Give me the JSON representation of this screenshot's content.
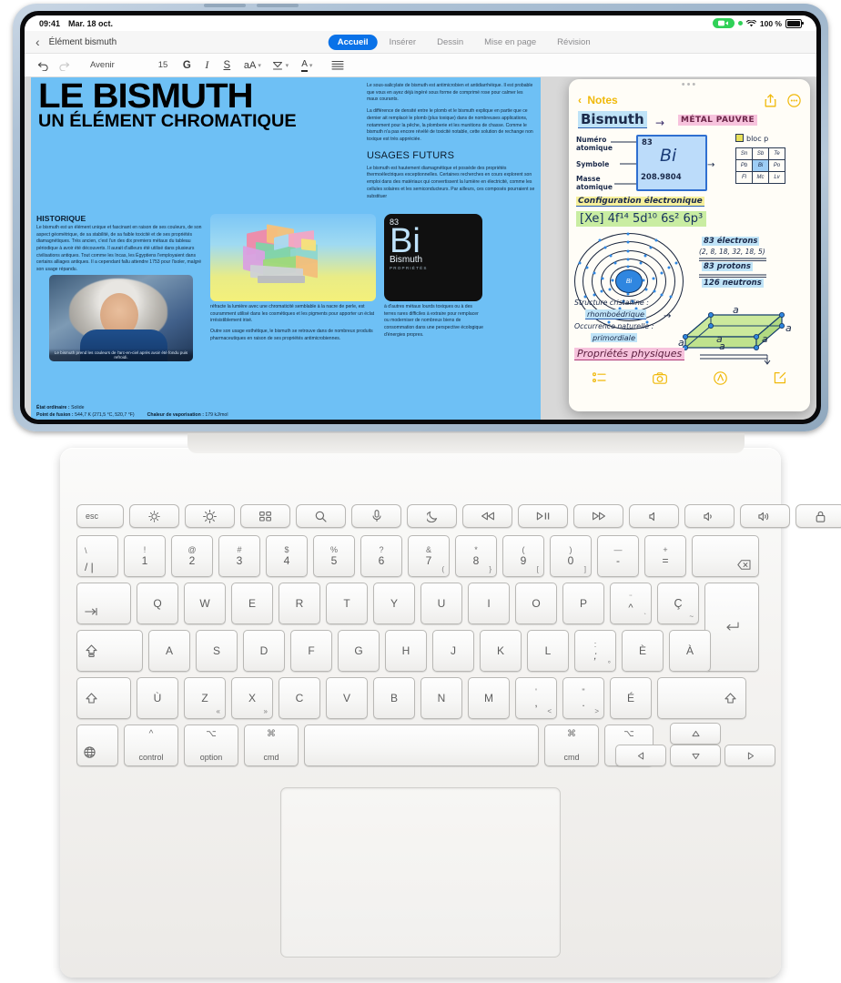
{
  "device": {
    "name": "iPad with Magic Keyboard"
  },
  "status_bar": {
    "time": "09:41",
    "date": "Mar. 18 oct.",
    "screen_record_icon": "video-record-icon",
    "privacy_dot": "green-privacy-dot",
    "wifi_icon": "wifi-icon",
    "battery_percent": "100 %",
    "battery_icon": "battery-icon"
  },
  "pages_app": {
    "back_icon": "chevron-left-icon",
    "document_title": "Élément bismuth",
    "tabs": [
      {
        "label": "Accueil",
        "active": true
      },
      {
        "label": "Insérer",
        "active": false
      },
      {
        "label": "Dessin",
        "active": false
      },
      {
        "label": "Mise en page",
        "active": false
      },
      {
        "label": "Révision",
        "active": false
      }
    ],
    "format_bar": {
      "undo_icon": "undo-icon",
      "redo_icon": "redo-icon",
      "font_name": "Avenir",
      "font_size": "15",
      "bold_label": "G",
      "italic_label": "I",
      "underline_label": "S",
      "text_style_label": "aA",
      "highlight_icon": "highlighter-icon",
      "text_color_label": "A",
      "list_icon": "bullet-list-icon",
      "caret_icon": "chevron-down-icon"
    }
  },
  "document": {
    "title_line1": "LE BISMUTH",
    "title_line2": "UN ÉLÉMENT CHROMATIQUE",
    "intro_paragraphs": [
      "Le sous-salicylate de bismuth est antimicrobien et antidiarrhéique. Il est probable que vous en ayez déjà ingéré sous forme de comprimé rose pour calmer les maux courants.",
      "La différence de densité entre le plomb et le bismuth explique en partie que ce dernier ait remplacé le plomb (plus toxique) dans de nombreuses applications, notamment pour la pêche, la plomberie et les munitions de chasse. Comme le bismuth n'a pas encore révélé de toxicité notable, cette solution de rechange non toxique est très appréciée."
    ],
    "section_future_title": "USAGES FUTURS",
    "section_future_text": "Le bismuth est hautement diamagnétique et possède des propriétés thermoélectriques exceptionnelles. Certaines recherches en cours explorent son emploi dans des matériaux qui convertissent la lumière en électricité, comme les cellules solaires et les semiconducteurs. Par ailleurs, ces composés pourraient se substituer",
    "section_historic_title": "HISTORIQUE",
    "section_historic_text": "Le bismuth est un élément unique et fascinant en raison de ses couleurs, de son aspect géométrique, de sa stabilité, de sa faible toxicité et de ses propriétés diamagnétiques. Très ancien, c'est l'un des dix premiers métaux du tableau périodique à avoir été découverts. Il aurait d'ailleurs été utilisé dans plusieurs civilisations antiques. Tout comme les Incas, les Égyptiens l'employaient dans certains alliages antiques. Il a cependant fallu attendre 1753 pour l'isoler, malgré son usage répandu.",
    "photo_caption": "Le bismuth prend les couleurs de l'arc-en-ciel après avoir été fondu puis refroidi.",
    "crystal_text": "réfracte la lumière avec une chromaticité semblable à la nacre de perle, est couramment utilisé dans les cosmétiques et les pigments pour apporter un éclat irrésistiblement irisé.",
    "crystal_text2": "Outre son usage esthétique, le bismuth se retrouve dans de nombreux produits pharmaceutiques en raison de ses propriétés antimicrobiennes.",
    "element_card": {
      "atomic_number": "83",
      "symbol": "Bi",
      "name": "Bismuth",
      "subtitle": "PROPRIÉTÉS"
    },
    "element_text": "à d'autres métaux lourds toxiques ou à des terres rares difficiles à extraire pour remplacer ou moderniser de nombreux biens de consommation dans une perspective écologique d'énergies propres.",
    "properties": [
      {
        "label": "État ordinaire :",
        "value": "Solide"
      },
      {
        "label": "Point de fusion :",
        "value": "544,7 K (271,5 °C, 520,7 °F)"
      },
      {
        "label": "Chaleur de vaporisation :",
        "value": "179 kJ/mol"
      }
    ]
  },
  "notes_app": {
    "back_label": "Notes",
    "back_icon": "chevron-left-icon",
    "share_icon": "share-icon",
    "more_icon": "more-circle-icon",
    "toolbar": {
      "checklist_icon": "checklist-icon",
      "camera_icon": "camera-icon",
      "markup_icon": "markup-pen-icon",
      "compose_icon": "compose-icon"
    },
    "note": {
      "title": "Bismuth",
      "arrow": "→",
      "category": "MÉTAL PAUVRE",
      "label_atomic_number": "Numéro\natomique",
      "label_symbol": "Symbole",
      "label_atomic_mass": "Masse\natomique",
      "atomic_number": "83",
      "symbol": "Bi",
      "atomic_mass": "208.9804",
      "block_label": "bloc p",
      "mini_table": [
        [
          "Sn",
          "Sb",
          "Te"
        ],
        [
          "Pb",
          "Bi",
          "Po"
        ],
        [
          "Fl",
          "Mc",
          "Lv"
        ]
      ],
      "mini_table_highlight": "Bi",
      "config_label": "Configuration électronique",
      "config_value": "[Xe] 4f¹⁴ 5d¹⁰ 6s² 6p³",
      "electrons": "83 électrons",
      "electron_shells": "(2, 8, 18, 32, 18, 5)",
      "protons": "83 protons",
      "neutrons": "126 neutrons",
      "crystal_label": "Structure cristalline :",
      "crystal_value": "rhomboédrique",
      "occurrence_label": "Occurrence naturelle :",
      "occurrence_value": "primordiale",
      "physical_props_label": "Propriétés physiques",
      "lattice_letter": "a"
    }
  },
  "keyboard": {
    "function_row": [
      {
        "label": "esc",
        "icon": ""
      },
      {
        "label": "",
        "icon": "brightness-down-icon"
      },
      {
        "label": "",
        "icon": "brightness-up-icon"
      },
      {
        "label": "",
        "icon": "mission-control-icon"
      },
      {
        "label": "",
        "icon": "search-icon"
      },
      {
        "label": "",
        "icon": "dictation-mic-icon"
      },
      {
        "label": "",
        "icon": "do-not-disturb-moon-icon"
      },
      {
        "label": "",
        "icon": "rewind-icon"
      },
      {
        "label": "",
        "icon": "play-pause-icon"
      },
      {
        "label": "",
        "icon": "fast-forward-icon"
      },
      {
        "label": "",
        "icon": "mute-icon"
      },
      {
        "label": "",
        "icon": "volume-down-icon"
      },
      {
        "label": "",
        "icon": "volume-up-icon"
      },
      {
        "label": "",
        "icon": "lock-icon"
      }
    ],
    "number_row": [
      {
        "top": "\\",
        "bottom": "/ |"
      },
      {
        "top": "!",
        "bottom": "1"
      },
      {
        "top": "@",
        "bottom": "2"
      },
      {
        "top": "#",
        "bottom": "3"
      },
      {
        "top": "$",
        "bottom": "4"
      },
      {
        "top": "%",
        "bottom": "5"
      },
      {
        "top": "?",
        "bottom": "6"
      },
      {
        "top": "&",
        "bottom": "7",
        "br": "("
      },
      {
        "top": "*",
        "bottom": "8",
        "br": "}"
      },
      {
        "top": "(",
        "bottom": "9",
        "br": "["
      },
      {
        "top": ")",
        "bottom": "0",
        "br": "]"
      },
      {
        "top": "—",
        "bottom": "-"
      },
      {
        "top": "+",
        "bottom": "="
      },
      {
        "top": "",
        "bottom": "",
        "icon": "delete-backward-icon"
      }
    ],
    "row_q": [
      "Q",
      "W",
      "E",
      "R",
      "T",
      "Y",
      "U",
      "I",
      "O",
      "P"
    ],
    "row_q_tab_icon": "tab-icon",
    "key_circumflex": {
      "top": "¨",
      "mid": "^",
      "br": "`"
    },
    "key_cedilla": {
      "main": "Ç",
      "br": "~"
    },
    "return_icon": "return-icon",
    "row_a": [
      "A",
      "S",
      "D",
      "F",
      "G",
      "H",
      "J",
      "K",
      "L"
    ],
    "row_a_capslock_icon": "caps-lock-icon",
    "key_semicolon": {
      "top": ":",
      "bottom": ";",
      "br": "°"
    },
    "key_egrave": "È",
    "key_agrave": "À",
    "row_z_first": "Ù",
    "row_z": [
      "Z",
      "X",
      "C",
      "V",
      "B",
      "N",
      "M"
    ],
    "row_z_shift_icon": "shift-icon",
    "key_z_br": "«",
    "key_x_br": "»",
    "key_apostrophe": {
      "top": "'",
      "bottom": ",",
      "br": "<"
    },
    "key_quote": {
      "top": "\"",
      "bottom": ".",
      "br": ">"
    },
    "key_eacute": "É",
    "bottom_row": {
      "globe_icon": "globe-icon",
      "control": {
        "symbol": "^",
        "label": "control"
      },
      "option": {
        "symbol": "⌥",
        "label": "option"
      },
      "cmd": {
        "symbol": "⌘",
        "label": "cmd"
      },
      "space": "",
      "cmd_right": {
        "symbol": "⌘",
        "label": "cmd"
      },
      "opt_right": {
        "symbol": "⌥",
        "label": "opt"
      },
      "arrow_left_icon": "arrow-left-icon",
      "arrow_up_icon": "arrow-up-icon",
      "arrow_down_icon": "arrow-down-icon",
      "arrow_right_icon": "arrow-right-icon"
    },
    "trackpad": "trackpad"
  }
}
